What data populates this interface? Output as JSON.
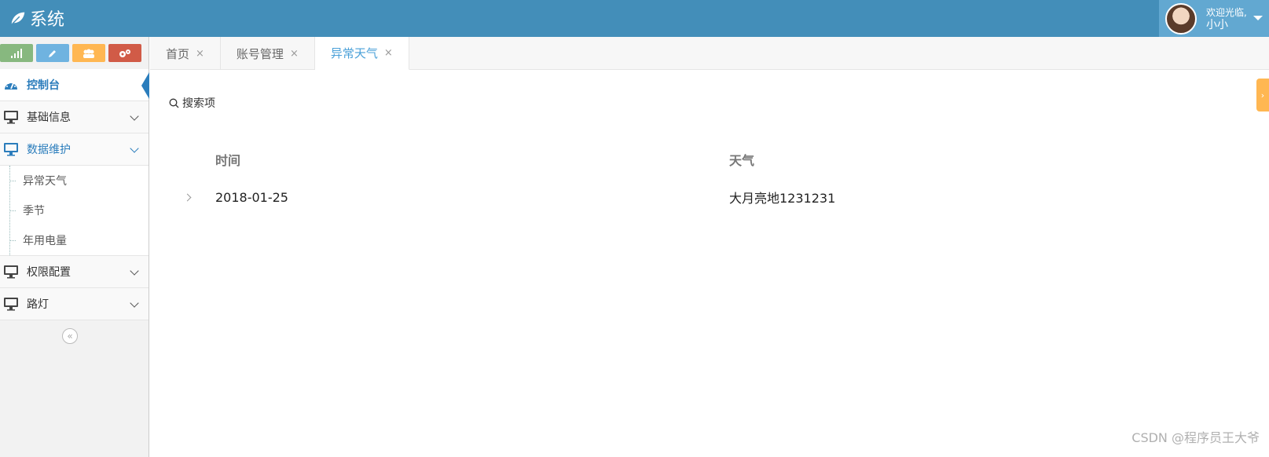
{
  "app": {
    "title": "系统"
  },
  "user": {
    "welcome": "欢迎光临,",
    "name": "小小"
  },
  "sidebar": {
    "shortcuts": [
      {
        "icon": "signal-icon",
        "color": "#87b87f"
      },
      {
        "icon": "pencil-icon",
        "color": "#6fb3e0"
      },
      {
        "icon": "users-icon",
        "color": "#ffb752"
      },
      {
        "icon": "cogs-icon",
        "color": "#d15b47"
      }
    ],
    "items": [
      {
        "label": "控制台",
        "icon": "dashboard-icon",
        "active": true
      },
      {
        "label": "基础信息",
        "icon": "desktop-icon"
      },
      {
        "label": "数据维护",
        "icon": "desktop-icon",
        "open": true,
        "children": [
          "异常天气",
          "季节",
          "年用电量"
        ]
      },
      {
        "label": "权限配置",
        "icon": "desktop-icon"
      },
      {
        "label": "路灯",
        "icon": "desktop-icon"
      }
    ],
    "collapse_glyph": "«"
  },
  "tabs": [
    {
      "label": "首页",
      "close": "×"
    },
    {
      "label": "账号管理",
      "close": "×"
    },
    {
      "label": "异常天气",
      "close": "×",
      "active": true
    }
  ],
  "main": {
    "search_label": "搜索项",
    "table": {
      "headers": [
        "时间",
        "天气"
      ],
      "rows": [
        [
          "2018-01-25",
          "大月亮地1231231"
        ]
      ]
    }
  },
  "watermark": "CSDN @程序员王大爷",
  "colors": {
    "navbar": "#438eb9",
    "accent": "#2b7dbc",
    "tab_active": "#4aa0d8"
  }
}
